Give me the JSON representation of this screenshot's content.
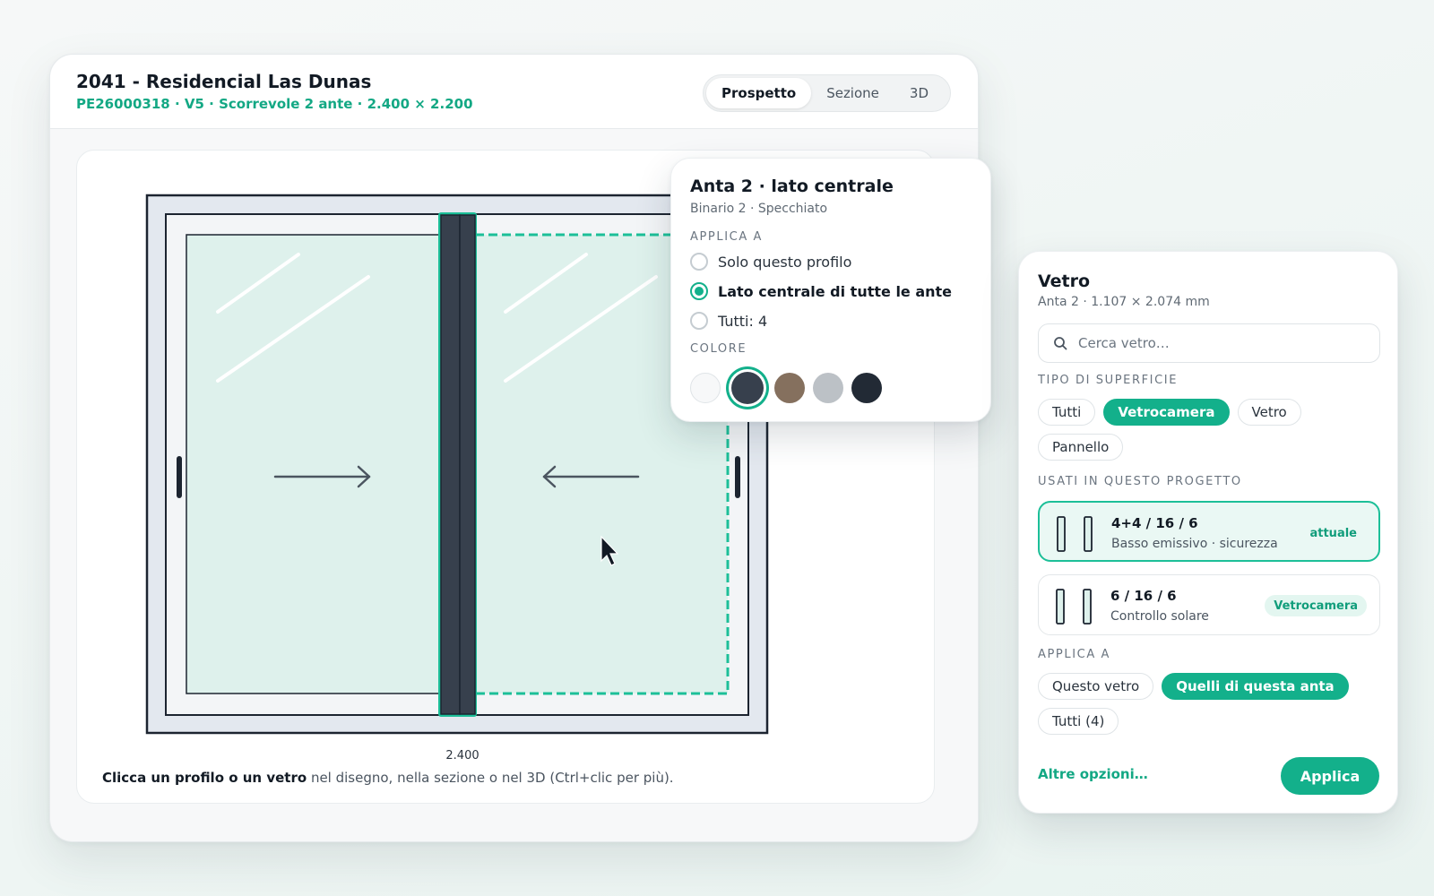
{
  "project": {
    "title": "2041 - Residencial Las Dunas",
    "subtitle": "PE26000318 · V5 · Scorrevole 2 ante · 2.400 × 2.200"
  },
  "view_tabs": [
    "Prospetto",
    "Sezione",
    "3D"
  ],
  "active_view": "Prospetto",
  "drawing": {
    "dimension": "2.400",
    "hint_bold": "Clicca un profilo o un vetro",
    "hint_rest": " nel disegno, nella sezione o nel 3D (Ctrl+clic per più)."
  },
  "profile_popover": {
    "title": "Anta 2 · lato centrale",
    "subtitle": "Binario 2 · Specchiato",
    "apply_label": "APPLICA A",
    "options": [
      "Solo questo profilo",
      "Lato centrale di tutte le ante",
      "Tutti: 4"
    ],
    "selected_option": "Lato centrale di tutte le ante",
    "color_label": "COLORE",
    "colors": [
      "#f7f8f9",
      "#37404d",
      "#85705e",
      "#bcc1c6",
      "#222a35"
    ],
    "selected_color": "#37404d"
  },
  "glass_panel": {
    "title": "Vetro",
    "subtitle": "Anta 2 · 1.107 × 2.074 mm",
    "search_placeholder": "Cerca vetro…",
    "surface_label": "TIPO DI SUPERFICIE",
    "surface_chips": [
      "Tutti",
      "Vetrocamera",
      "Vetro",
      "Pannello"
    ],
    "surface_active": "Vetrocamera",
    "used_label": "USATI IN QUESTO PROGETTO",
    "used_items": [
      {
        "name": "4+4 / 16 / 6",
        "desc": "Basso emissivo · sicurezza",
        "badge": "attuale"
      },
      {
        "name": "6 / 16 / 6",
        "desc": "Controllo solare",
        "badge": "Vetrocamera"
      }
    ],
    "apply_label": "APPLICA A",
    "apply_chips": [
      "Questo vetro",
      "Quelli di questa anta",
      "Tutti (4)"
    ],
    "apply_active": "Quelli di questa anta",
    "more_link": "Altre opzioni…",
    "apply_button": "Applica"
  },
  "colors": {
    "accent": "#13b08b",
    "glass_fill": "#def1ec",
    "frame_dark": "#37404d"
  }
}
